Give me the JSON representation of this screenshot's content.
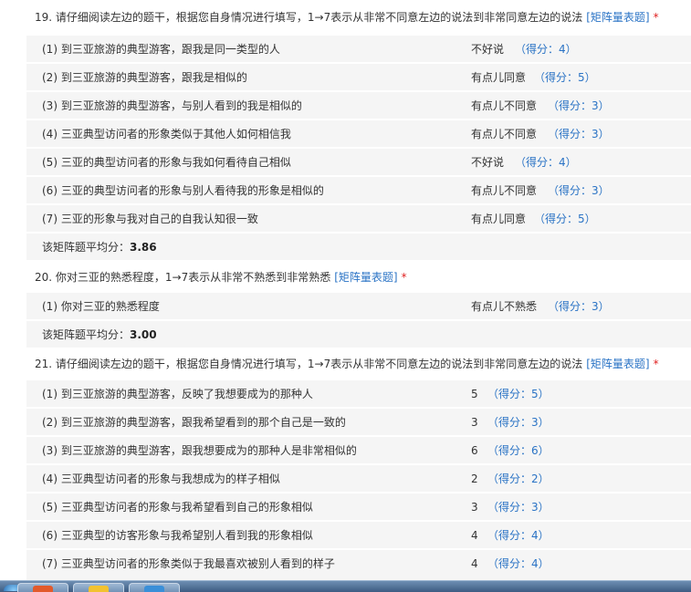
{
  "q19": {
    "title": "19. 请仔细阅读左边的题干，根据您自身情况进行填写，1→7表示从非常不同意左边的说法到非常同意左边的说法",
    "type_link": "[矩阵量表题]",
    "required": "*",
    "rows": [
      {
        "label": "(1) 到三亚旅游的典型游客，跟我是同一类型的人",
        "answer": "不好说",
        "score": "（得分：4）"
      },
      {
        "label": "(2) 到三亚旅游的典型游客，跟我是相似的",
        "answer": "有点儿同意",
        "score": "（得分：5）"
      },
      {
        "label": "(3) 到三亚旅游的典型游客，与别人看到的我是相似的",
        "answer": "有点儿不同意",
        "score": "（得分：3）"
      },
      {
        "label": "(4) 三亚典型访问者的形象类似于其他人如何相信我",
        "answer": "有点儿不同意",
        "score": "（得分：3）"
      },
      {
        "label": "(5) 三亚的典型访问者的形象与我如何看待自己相似",
        "answer": "不好说",
        "score": "（得分：4）"
      },
      {
        "label": "(6) 三亚的典型访问者的形象与别人看待我的形象是相似的",
        "answer": "有点儿不同意",
        "score": "（得分：3）"
      },
      {
        "label": "(7) 三亚的形象与我对自己的自我认知很一致",
        "answer": "有点儿同意",
        "score": "（得分：5）"
      }
    ],
    "avg_label": "该矩阵题平均分：",
    "avg_value": "3.86"
  },
  "q20": {
    "title": "20. 你对三亚的熟悉程度，1→7表示从非常不熟悉到非常熟悉",
    "type_link": "[矩阵量表题]",
    "required": "*",
    "rows": [
      {
        "label": "(1) 你对三亚的熟悉程度",
        "answer": "有点儿不熟悉",
        "score": "（得分：3）"
      }
    ],
    "avg_label": "该矩阵题平均分：",
    "avg_value": "3.00"
  },
  "q21": {
    "title": "21. 请仔细阅读左边的题干，根据您自身情况进行填写，1→7表示从非常不同意左边的说法到非常同意左边的说法",
    "type_link": "[矩阵量表题]",
    "required": "*",
    "rows": [
      {
        "label": "(1) 到三亚旅游的典型游客，反映了我想要成为的那种人",
        "answer": "5",
        "score": "（得分：5）"
      },
      {
        "label": "(2) 到三亚旅游的典型游客，跟我希望看到的那个自己是一致的",
        "answer": "3",
        "score": "（得分：3）"
      },
      {
        "label": "(3) 到三亚旅游的典型游客，跟我想要成为的那种人是非常相似的",
        "answer": "6",
        "score": "（得分：6）"
      },
      {
        "label": "(4) 三亚典型访问者的形象与我想成为的样子相似",
        "answer": "2",
        "score": "（得分：2）"
      },
      {
        "label": "(5) 三亚典型访问者的形象与我希望看到自己的形象相似",
        "answer": "3",
        "score": "（得分：3）"
      },
      {
        "label": "(6) 三亚典型的访客形象与我希望别人看到我的形象相似",
        "answer": "4",
        "score": "（得分：4）"
      },
      {
        "label": "(7) 三亚典型访问者的形象类似于我最喜欢被别人看到的样子",
        "answer": "4",
        "score": "（得分：4）"
      }
    ]
  },
  "colors": {
    "link": "#2a73c5",
    "required": "#e02020",
    "row_bg": "#f5f5f5",
    "taskbar": "#3d5c82"
  },
  "taskbar": {
    "icons": [
      "start-orb-icon",
      "app-icon",
      "browser-icon"
    ]
  }
}
